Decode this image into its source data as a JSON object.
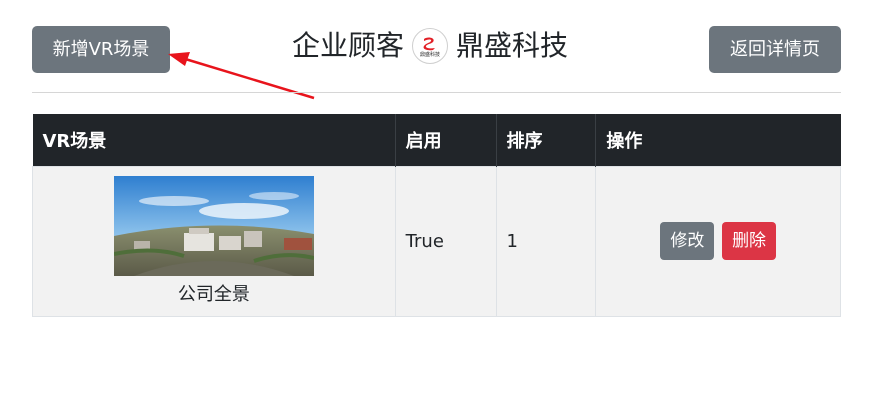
{
  "header": {
    "add_button": "新增VR场景",
    "title_left": "企业顾客",
    "logo_text": "鼎盛科技",
    "title_right": "鼎盛科技",
    "back_button": "返回详情页"
  },
  "table": {
    "columns": [
      "VR场景",
      "启用",
      "排序",
      "操作"
    ],
    "rows": [
      {
        "scene_name": "公司全景",
        "enabled": "True",
        "order": "1",
        "edit_label": "修改",
        "delete_label": "删除"
      }
    ]
  },
  "colors": {
    "header_bg": "#212529",
    "gray_button": "#6c757d",
    "danger_button": "#dc3545",
    "arrow": "#e8141c"
  }
}
